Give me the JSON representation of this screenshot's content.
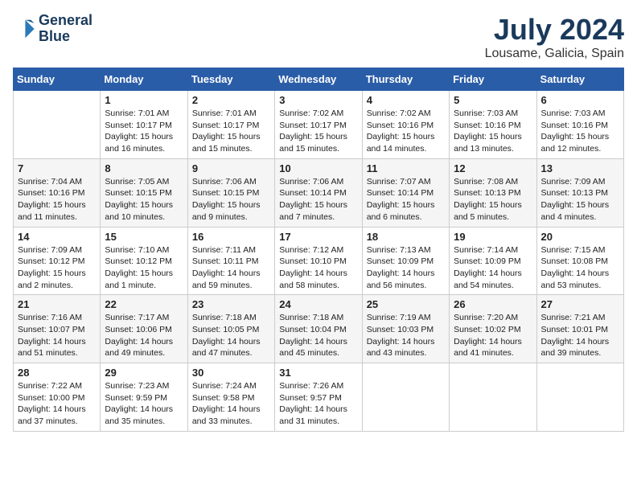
{
  "header": {
    "logo_line1": "General",
    "logo_line2": "Blue",
    "month_title": "July 2024",
    "location": "Lousame, Galicia, Spain"
  },
  "days_of_week": [
    "Sunday",
    "Monday",
    "Tuesday",
    "Wednesday",
    "Thursday",
    "Friday",
    "Saturday"
  ],
  "weeks": [
    [
      {
        "day": "",
        "info": ""
      },
      {
        "day": "1",
        "info": "Sunrise: 7:01 AM\nSunset: 10:17 PM\nDaylight: 15 hours\nand 16 minutes."
      },
      {
        "day": "2",
        "info": "Sunrise: 7:01 AM\nSunset: 10:17 PM\nDaylight: 15 hours\nand 15 minutes."
      },
      {
        "day": "3",
        "info": "Sunrise: 7:02 AM\nSunset: 10:17 PM\nDaylight: 15 hours\nand 15 minutes."
      },
      {
        "day": "4",
        "info": "Sunrise: 7:02 AM\nSunset: 10:16 PM\nDaylight: 15 hours\nand 14 minutes."
      },
      {
        "day": "5",
        "info": "Sunrise: 7:03 AM\nSunset: 10:16 PM\nDaylight: 15 hours\nand 13 minutes."
      },
      {
        "day": "6",
        "info": "Sunrise: 7:03 AM\nSunset: 10:16 PM\nDaylight: 15 hours\nand 12 minutes."
      }
    ],
    [
      {
        "day": "7",
        "info": "Sunrise: 7:04 AM\nSunset: 10:16 PM\nDaylight: 15 hours\nand 11 minutes."
      },
      {
        "day": "8",
        "info": "Sunrise: 7:05 AM\nSunset: 10:15 PM\nDaylight: 15 hours\nand 10 minutes."
      },
      {
        "day": "9",
        "info": "Sunrise: 7:06 AM\nSunset: 10:15 PM\nDaylight: 15 hours\nand 9 minutes."
      },
      {
        "day": "10",
        "info": "Sunrise: 7:06 AM\nSunset: 10:14 PM\nDaylight: 15 hours\nand 7 minutes."
      },
      {
        "day": "11",
        "info": "Sunrise: 7:07 AM\nSunset: 10:14 PM\nDaylight: 15 hours\nand 6 minutes."
      },
      {
        "day": "12",
        "info": "Sunrise: 7:08 AM\nSunset: 10:13 PM\nDaylight: 15 hours\nand 5 minutes."
      },
      {
        "day": "13",
        "info": "Sunrise: 7:09 AM\nSunset: 10:13 PM\nDaylight: 15 hours\nand 4 minutes."
      }
    ],
    [
      {
        "day": "14",
        "info": "Sunrise: 7:09 AM\nSunset: 10:12 PM\nDaylight: 15 hours\nand 2 minutes."
      },
      {
        "day": "15",
        "info": "Sunrise: 7:10 AM\nSunset: 10:12 PM\nDaylight: 15 hours\nand 1 minute."
      },
      {
        "day": "16",
        "info": "Sunrise: 7:11 AM\nSunset: 10:11 PM\nDaylight: 14 hours\nand 59 minutes."
      },
      {
        "day": "17",
        "info": "Sunrise: 7:12 AM\nSunset: 10:10 PM\nDaylight: 14 hours\nand 58 minutes."
      },
      {
        "day": "18",
        "info": "Sunrise: 7:13 AM\nSunset: 10:09 PM\nDaylight: 14 hours\nand 56 minutes."
      },
      {
        "day": "19",
        "info": "Sunrise: 7:14 AM\nSunset: 10:09 PM\nDaylight: 14 hours\nand 54 minutes."
      },
      {
        "day": "20",
        "info": "Sunrise: 7:15 AM\nSunset: 10:08 PM\nDaylight: 14 hours\nand 53 minutes."
      }
    ],
    [
      {
        "day": "21",
        "info": "Sunrise: 7:16 AM\nSunset: 10:07 PM\nDaylight: 14 hours\nand 51 minutes."
      },
      {
        "day": "22",
        "info": "Sunrise: 7:17 AM\nSunset: 10:06 PM\nDaylight: 14 hours\nand 49 minutes."
      },
      {
        "day": "23",
        "info": "Sunrise: 7:18 AM\nSunset: 10:05 PM\nDaylight: 14 hours\nand 47 minutes."
      },
      {
        "day": "24",
        "info": "Sunrise: 7:18 AM\nSunset: 10:04 PM\nDaylight: 14 hours\nand 45 minutes."
      },
      {
        "day": "25",
        "info": "Sunrise: 7:19 AM\nSunset: 10:03 PM\nDaylight: 14 hours\nand 43 minutes."
      },
      {
        "day": "26",
        "info": "Sunrise: 7:20 AM\nSunset: 10:02 PM\nDaylight: 14 hours\nand 41 minutes."
      },
      {
        "day": "27",
        "info": "Sunrise: 7:21 AM\nSunset: 10:01 PM\nDaylight: 14 hours\nand 39 minutes."
      }
    ],
    [
      {
        "day": "28",
        "info": "Sunrise: 7:22 AM\nSunset: 10:00 PM\nDaylight: 14 hours\nand 37 minutes."
      },
      {
        "day": "29",
        "info": "Sunrise: 7:23 AM\nSunset: 9:59 PM\nDaylight: 14 hours\nand 35 minutes."
      },
      {
        "day": "30",
        "info": "Sunrise: 7:24 AM\nSunset: 9:58 PM\nDaylight: 14 hours\nand 33 minutes."
      },
      {
        "day": "31",
        "info": "Sunrise: 7:26 AM\nSunset: 9:57 PM\nDaylight: 14 hours\nand 31 minutes."
      },
      {
        "day": "",
        "info": ""
      },
      {
        "day": "",
        "info": ""
      },
      {
        "day": "",
        "info": ""
      }
    ]
  ]
}
